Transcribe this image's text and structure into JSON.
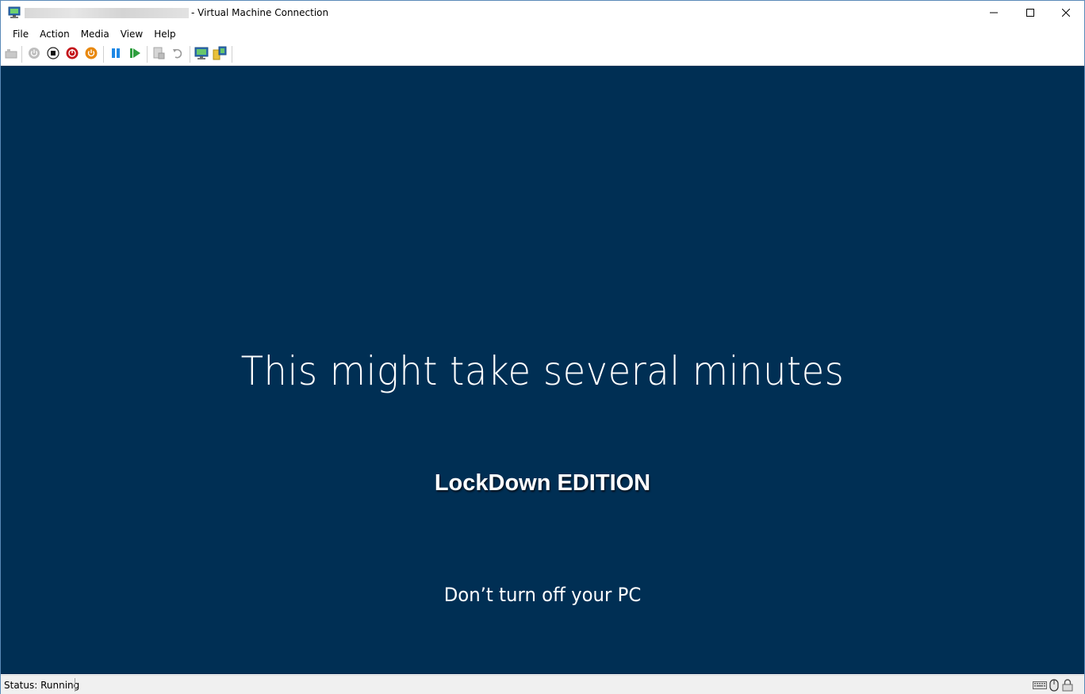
{
  "window": {
    "title_suffix": "- Virtual Machine Connection",
    "icons": {
      "app": "vm-connection-icon",
      "minimize": "minimize-icon",
      "maximize": "maximize-icon",
      "close": "close-icon"
    }
  },
  "menu": {
    "items": [
      "File",
      "Action",
      "Media",
      "View",
      "Help"
    ]
  },
  "toolbar": {
    "buttons": [
      "ctrl-alt-del-icon",
      "start-icon",
      "turn-off-icon",
      "shut-down-icon",
      "save-icon",
      "pause-icon",
      "reset-icon",
      "checkpoint-icon",
      "revert-icon",
      "enhanced-session-icon",
      "share-icon"
    ]
  },
  "vm": {
    "main_text": "This might take several minutes",
    "edition_text": "LockDown EDITION",
    "sub_text": "Don’t turn off your PC",
    "background": "#002f54"
  },
  "status": {
    "text": "Status: Running",
    "icons": [
      "keyboard-icon",
      "mouse-icon",
      "lock-icon"
    ]
  }
}
